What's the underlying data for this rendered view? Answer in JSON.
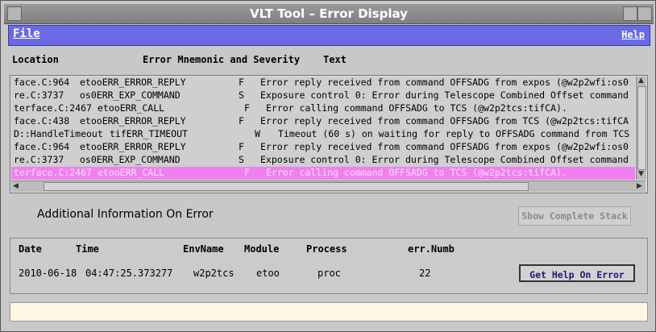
{
  "window": {
    "title": "VLT Tool – Error Display"
  },
  "menu": {
    "file": "File",
    "help": "Help"
  },
  "headers": {
    "location": "Location",
    "mnemonic": "Error Mnemonic and Severity",
    "text": "Text"
  },
  "errors": [
    {
      "location": "face.C:964",
      "mnemonic": "etooERR_ERROR_REPLY",
      "severity": "F",
      "text": "Error reply received from command OFFSADG from expos (@w2p2wfi:os0",
      "selected": false
    },
    {
      "location": "re.C:3737",
      "mnemonic": "os0ERR_EXP_COMMAND",
      "severity": "S",
      "text": "Exposure control 0: Error during Telescope Combined Offset command",
      "selected": false
    },
    {
      "location": "terface.C:2467",
      "mnemonic": "etooERR_CALL",
      "severity": "F",
      "text": "Error calling command OFFSADG to TCS (@w2p2tcs:tifCA).",
      "selected": false
    },
    {
      "location": "face.C:438",
      "mnemonic": "etooERR_ERROR_REPLY",
      "severity": "F",
      "text": "Error reply received from command OFFSADG from TCS (@w2p2tcs:tifCA",
      "selected": false
    },
    {
      "location": "D::HandleTimeout",
      "mnemonic": "tifERR_TIMEOUT",
      "severity": "W",
      "text": "Timeout (60 s) on waiting for reply to OFFSADG command from TCS",
      "selected": false
    },
    {
      "location": "face.C:964",
      "mnemonic": "etooERR_ERROR_REPLY",
      "severity": "F",
      "text": "Error reply received from command OFFSADG from expos (@w2p2wfi:os0",
      "selected": false
    },
    {
      "location": "re.C:3737",
      "mnemonic": "os0ERR_EXP_COMMAND",
      "severity": "S",
      "text": "Exposure control 0: Error during Telescope Combined Offset command",
      "selected": false
    },
    {
      "location": "terface.C:2467",
      "mnemonic": "etooERR_CALL",
      "severity": "F",
      "text": "Error calling command OFFSADG to TCS (@w2p2tcs:tifCA).",
      "selected": true
    }
  ],
  "additional": {
    "label": "Additional Information On Error",
    "show_stack": "Show Complete Stack"
  },
  "info": {
    "headers": {
      "date": "Date",
      "time": "Time",
      "envname": "EnvName",
      "module": "Module",
      "process": "Process",
      "errnumb": "err.Numb"
    },
    "values": {
      "date": "2010-06-18",
      "time": "04:47:25.373277",
      "envname": "w2p2tcs",
      "module": "etoo",
      "process": "proc",
      "errnumb": "22"
    },
    "get_help": "Get Help On Error"
  },
  "status": {
    "text": ""
  },
  "colors": {
    "menubar": "#6a6ae6",
    "selected_row": "#f080f0",
    "status_bg": "#fdf7e3"
  }
}
